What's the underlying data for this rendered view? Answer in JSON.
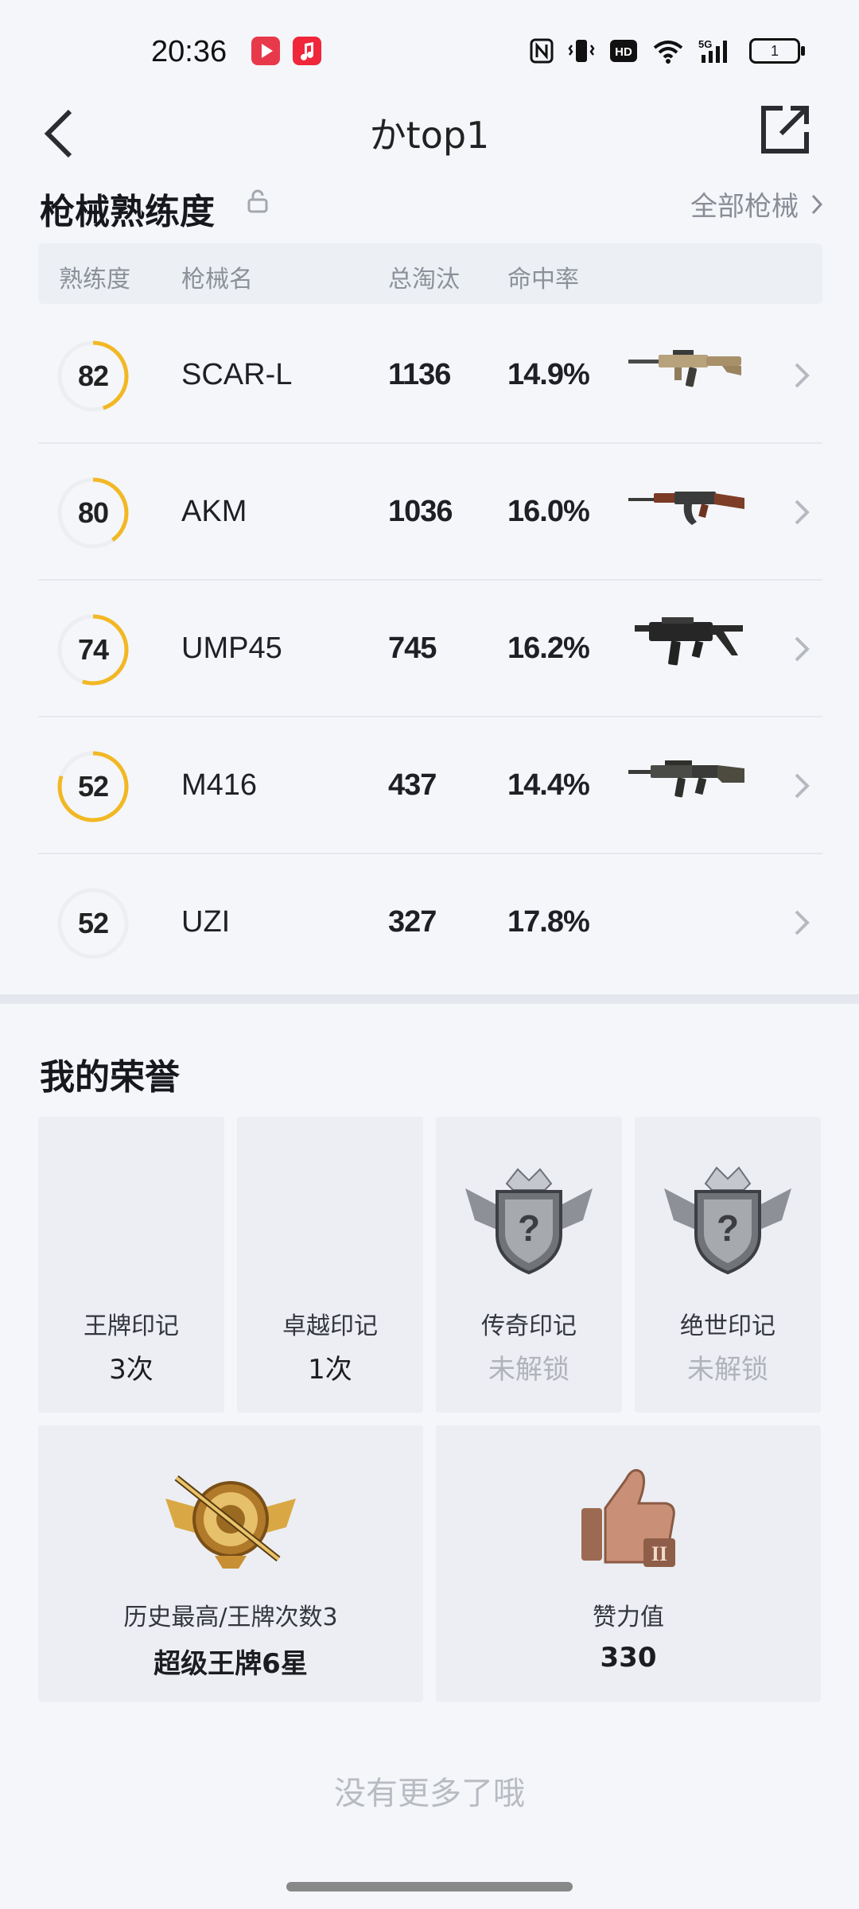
{
  "status_bar": {
    "time": "20:36",
    "network": "5G",
    "hd": "HD",
    "battery": "1"
  },
  "header": {
    "title": "かtop1"
  },
  "weapons": {
    "title": "枪械熟练度",
    "all_link": "全部枪械",
    "columns": [
      "熟练度",
      "枪械名",
      "总淘汰",
      "命中率"
    ],
    "rows": [
      {
        "proficiency": "82",
        "proficiency_fraction": 0.45,
        "name": "SCAR-L",
        "kills": "1136",
        "hit_rate": "14.9%",
        "gun_icon": "scar-l-rifle"
      },
      {
        "proficiency": "80",
        "proficiency_fraction": 0.4,
        "name": "AKM",
        "kills": "1036",
        "hit_rate": "16.0%",
        "gun_icon": "akm-rifle"
      },
      {
        "proficiency": "74",
        "proficiency_fraction": 0.55,
        "name": "UMP45",
        "kills": "745",
        "hit_rate": "16.2%",
        "gun_icon": "ump45-smg"
      },
      {
        "proficiency": "52",
        "proficiency_fraction": 0.8,
        "name": "M416",
        "kills": "437",
        "hit_rate": "14.4%",
        "gun_icon": "m416-rifle"
      },
      {
        "proficiency": "52",
        "proficiency_fraction": 0.0,
        "name": "UZI",
        "kills": "327",
        "hit_rate": "17.8%",
        "gun_icon": ""
      }
    ]
  },
  "honors": {
    "title": "我的荣誉",
    "cards": [
      {
        "label": "王牌印记",
        "value": "3次",
        "icon": ""
      },
      {
        "label": "卓越印记",
        "value": "1次",
        "icon": ""
      },
      {
        "label": "传奇印记",
        "value": "未解锁",
        "icon": "locked-crown-badge"
      },
      {
        "label": "绝世印记",
        "value": "未解锁",
        "icon": "locked-crown-badge"
      },
      {
        "label": "历史最高/王牌次数3",
        "value": "超级王牌6星",
        "icon": "ace-rank-badge"
      },
      {
        "label": "赞力值",
        "value": "330",
        "icon": "thumbs-up-badge"
      }
    ]
  },
  "footer": {
    "no_more": "没有更多了哦"
  },
  "colors": {
    "ring_accent": "#f2b824",
    "ring_track": "#eceef2",
    "locked_text": "#b0b3ba"
  }
}
